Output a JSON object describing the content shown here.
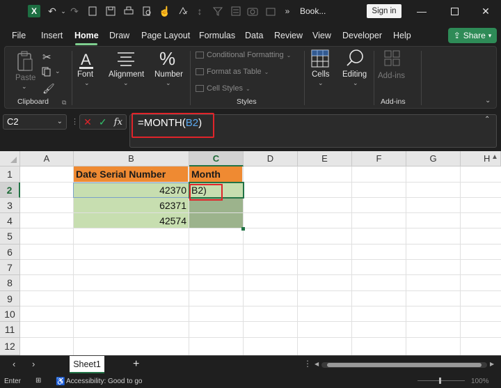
{
  "titlebar": {
    "document_name": "Book...",
    "sign_in_label": "Sign in",
    "overflow_label": "»"
  },
  "menu": {
    "items": [
      "File",
      "Insert",
      "Home",
      "Draw",
      "Page Layout",
      "Formulas",
      "Data",
      "Review",
      "View",
      "Developer",
      "Help"
    ],
    "active": "Home",
    "share_label": "Share"
  },
  "ribbon": {
    "clipboard": {
      "paste": "Paste",
      "group": "Clipboard"
    },
    "font": "Font",
    "alignment": "Alignment",
    "number": "Number",
    "styles": {
      "conditional": "Conditional Formatting",
      "format_table": "Format as Table",
      "cell_styles": "Cell Styles",
      "group": "Styles"
    },
    "cells": "Cells",
    "editing": "Editing",
    "addins": "Add-ins",
    "addins_group": "Add-ins"
  },
  "formula_bar": {
    "name_box": "C2",
    "fx": "fx",
    "formula_prefix": "=MONTH(",
    "formula_ref": "B2",
    "formula_suffix": ")"
  },
  "sheet": {
    "columns": [
      "A",
      "B",
      "C",
      "D",
      "E",
      "F",
      "G",
      "H"
    ],
    "rows": [
      "1",
      "2",
      "3",
      "4",
      "5",
      "6",
      "7",
      "8",
      "9",
      "10",
      "11",
      "12"
    ],
    "header_b": "Date Serial Number",
    "header_c": "Month",
    "b_values": [
      "42370",
      "62371",
      "42574"
    ],
    "c2_edit": "B2)"
  },
  "tabs": {
    "sheet_name": "Sheet1",
    "add": "+"
  },
  "status": {
    "mode": "Enter",
    "accessibility": "Accessibility: Good to go",
    "zoom": "100%"
  },
  "colors": {
    "header_orange": "#ef8a32",
    "data_green": "#c7deb0",
    "highlight_red": "#e0242a",
    "excel_green": "#217346"
  }
}
